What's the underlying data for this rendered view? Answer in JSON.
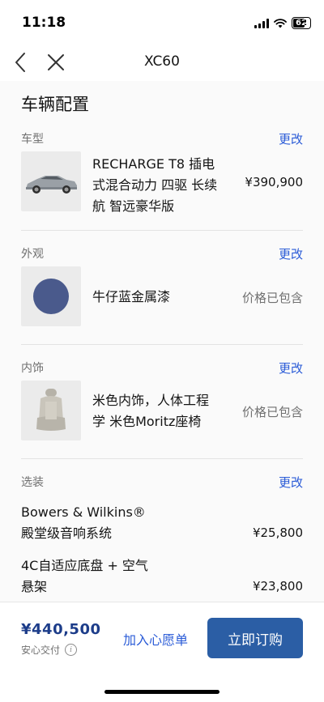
{
  "status_bar": {
    "time": "11:18",
    "battery": "62"
  },
  "nav": {
    "title": "XC60"
  },
  "page": {
    "title": "车辆配置"
  },
  "sections": {
    "model": {
      "label": "车型",
      "change": "更改",
      "name_line1": "RECHARGE T8 插电",
      "name_line2": "式混合动力 四驱 长续",
      "name_line3": "航 智远豪华版",
      "price": "¥390,900"
    },
    "exterior": {
      "label": "外观",
      "change": "更改",
      "name": "牛仔蓝金属漆",
      "price": "价格已包含",
      "swatch_color": "#4a5a8c"
    },
    "interior": {
      "label": "内饰",
      "change": "更改",
      "name_line1": "米色内饰，人体工程",
      "name_line2": "学 米色Moritz座椅",
      "price": "价格已包含"
    },
    "options": {
      "label": "选装",
      "change": "更改",
      "items": [
        {
          "name_line1": "Bowers & Wilkins®",
          "name_line2": "殿堂级音响系统",
          "price": "¥25,800"
        },
        {
          "name_line1": "4C自适应底盘 + 空气",
          "name_line2": "悬架",
          "price": "¥23,800"
        }
      ]
    }
  },
  "bottom": {
    "total": "¥440,500",
    "delivery": "安心交付",
    "wishlist": "加入心愿单",
    "buy": "立即订购"
  },
  "colors": {
    "accent": "#2a5bd7",
    "button": "#2b5ea5",
    "total": "#1d3d8a"
  }
}
